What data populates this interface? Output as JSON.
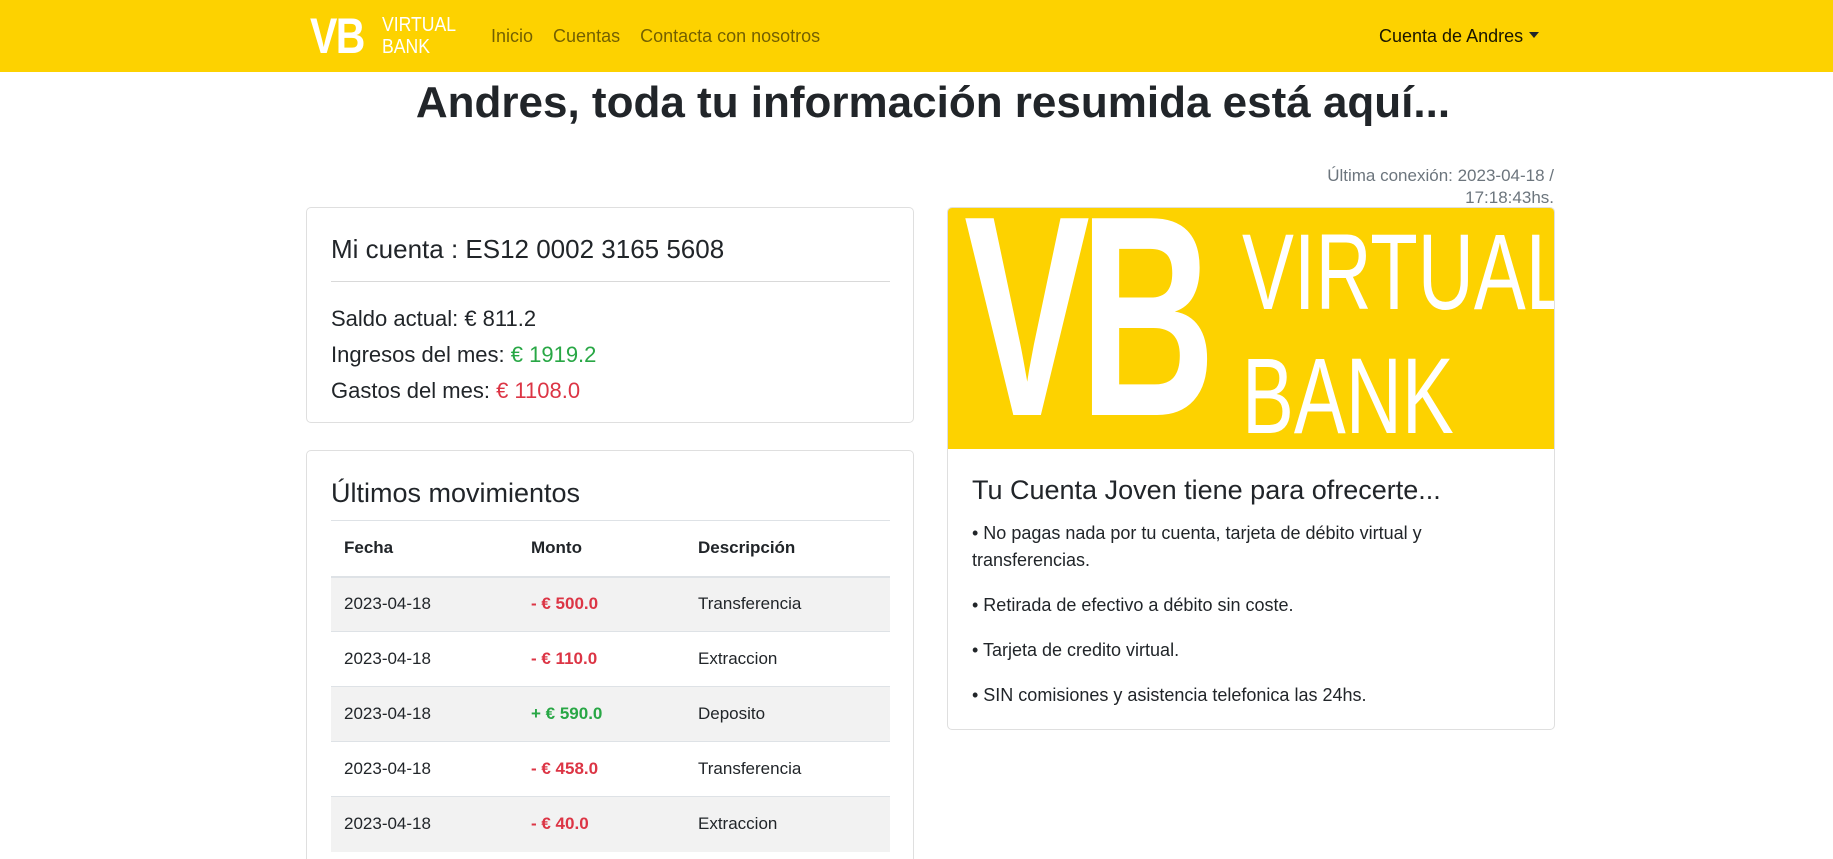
{
  "navbar": {
    "brand_mark": "VB",
    "brand_name_1": "VIRTUAL",
    "brand_name_2": "BANK",
    "links": [
      "Inicio",
      "Cuentas",
      "Contacta con nosotros"
    ],
    "user_menu": "Cuenta de Andres",
    "bg_color": "#fdd200"
  },
  "page": {
    "title": "Andres, toda tu información resumida está aquí...",
    "last_connection": "Última conexión: 2023-04-18 / 17:18:43hs."
  },
  "account": {
    "title": "Mi cuenta : ES12 0002 3165 5608",
    "balance_label": "Saldo actual:",
    "balance_value": "€ 811.2",
    "income_label": "Ingresos del mes:",
    "income_value": "€ 1919.2",
    "expenses_label": "Gastos del mes:",
    "expenses_value": "€ 1108.0"
  },
  "movements": {
    "title": "Últimos movimientos",
    "headers": [
      "Fecha",
      "Monto",
      "Descripción"
    ],
    "rows": [
      {
        "date": "2023-04-18",
        "amount": "- € 500.0",
        "desc": "Transferencia",
        "type": "debit"
      },
      {
        "date": "2023-04-18",
        "amount": "- € 110.0",
        "desc": "Extraccion",
        "type": "debit"
      },
      {
        "date": "2023-04-18",
        "amount": "+ € 590.0",
        "desc": "Deposito",
        "type": "credit"
      },
      {
        "date": "2023-04-18",
        "amount": "- € 458.0",
        "desc": "Transferencia",
        "type": "debit"
      },
      {
        "date": "2023-04-18",
        "amount": "- € 40.0",
        "desc": "Extraccion",
        "type": "debit"
      }
    ]
  },
  "promo": {
    "logo_mark": "VB",
    "logo_name_1": "VIRTUAL",
    "logo_name_2": "BANK",
    "title": "Tu Cuenta Joven tiene para ofrecerte...",
    "items": [
      "• No pagas nada por tu cuenta, tarjeta de débito virtual y transferencias.",
      "• Retirada de efectivo a débito sin coste.",
      "• Tarjeta de credito virtual.",
      "• SIN comisiones y asistencia telefonica las 24hs."
    ]
  },
  "colors": {
    "accent": "#fdd200",
    "positive": "#28a745",
    "negative": "#dc3545"
  }
}
